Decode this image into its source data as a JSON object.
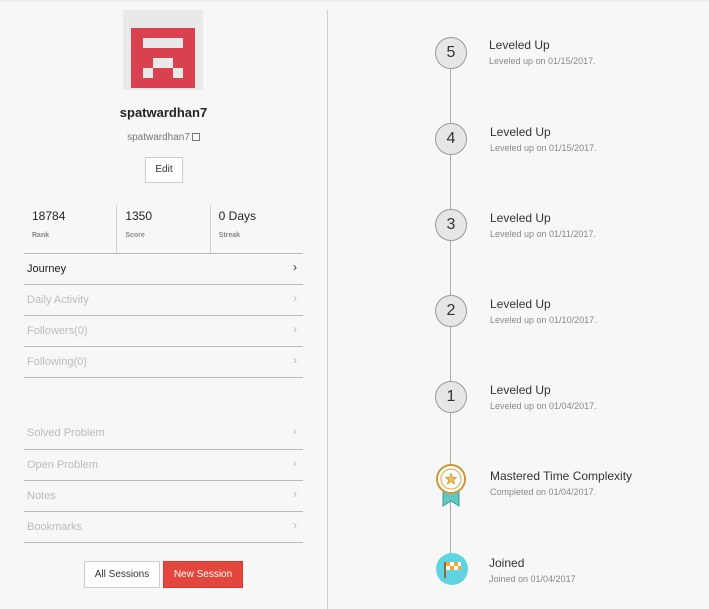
{
  "profile": {
    "username": "spatwardhan7",
    "handle": "spatwardhan7",
    "edit_label": "Edit",
    "avatar_color": "#d9414f"
  },
  "stats": [
    {
      "value": "18784",
      "label": "Rank"
    },
    {
      "value": "1350",
      "label": "Score"
    },
    {
      "value": "0 Days",
      "label": "Streak"
    }
  ],
  "menu_primary": [
    {
      "label": "Journey",
      "active": true
    },
    {
      "label": "Daily Activity",
      "active": false
    },
    {
      "label": "Followers(0)",
      "active": false
    },
    {
      "label": "Following(0)",
      "active": false
    }
  ],
  "menu_secondary": [
    {
      "label": "Solved Problem"
    },
    {
      "label": "Open Problem"
    },
    {
      "label": "Notes"
    },
    {
      "label": "Bookmarks"
    }
  ],
  "buttons": {
    "all_sessions": "All Sessions",
    "new_session": "New Session",
    "new_session_color": "#e2463c"
  },
  "timeline": [
    {
      "badge": "5",
      "title": "Leveled Up",
      "subtitle": "Leveled up on 01/15/2017.",
      "icon": "level-badge"
    },
    {
      "badge": "4",
      "title": "Leveled Up",
      "subtitle": "Leveled up on 01/15/2017.",
      "icon": "level-badge"
    },
    {
      "badge": "3",
      "title": "Leveled Up",
      "subtitle": "Leveled up on 01/11/2017.",
      "icon": "level-badge"
    },
    {
      "badge": "2",
      "title": "Leveled Up",
      "subtitle": "Leveled up on 01/10/2017.",
      "icon": "level-badge"
    },
    {
      "badge": "1",
      "title": "Leveled Up",
      "subtitle": "Leveled up on 01/04/2017.",
      "icon": "level-badge"
    },
    {
      "badge": "",
      "title": "Mastered Time Complexity",
      "subtitle": "Completed on 01/04/2017.",
      "icon": "medal-icon"
    },
    {
      "badge": "",
      "title": "Joined",
      "subtitle": "Joined on 01/04/2017",
      "icon": "checkered-flag-icon"
    }
  ]
}
